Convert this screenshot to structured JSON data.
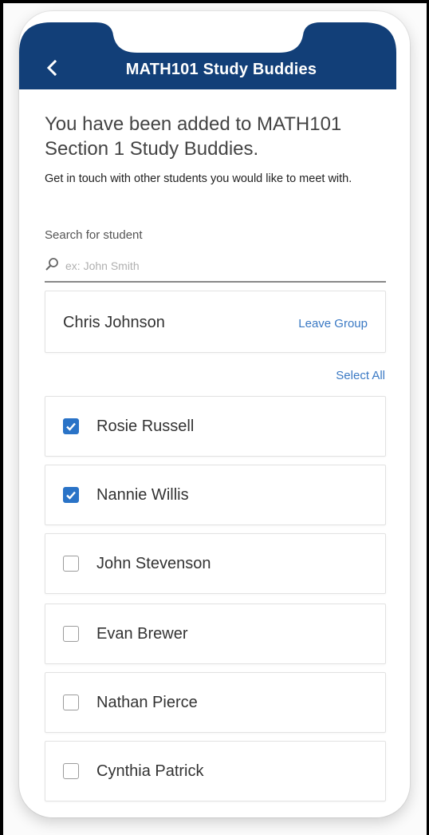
{
  "header": {
    "title": "MATH101 Study Buddies"
  },
  "intro": {
    "heading": "You have been added to MATH101 Section 1 Study Buddies.",
    "subtext": "Get in touch with other students you would like to meet with."
  },
  "search": {
    "label": "Search for student",
    "placeholder": "ex: John Smith",
    "value": ""
  },
  "owner": {
    "name": "Chris Johnson",
    "action": "Leave Group"
  },
  "select_all": "Select All",
  "students": [
    {
      "name": "Rosie Russell",
      "checked": true
    },
    {
      "name": "Nannie Willis",
      "checked": true
    },
    {
      "name": "John Stevenson",
      "checked": false
    },
    {
      "name": "Evan Brewer",
      "checked": false
    },
    {
      "name": "Nathan Pierce",
      "checked": false
    },
    {
      "name": "Cynthia Patrick",
      "checked": false
    }
  ],
  "colors": {
    "header": "#123f78",
    "accent": "#3a79c4",
    "check": "#2a73c7"
  },
  "icons": {
    "back": "chevron-left-icon",
    "search": "search-icon",
    "check": "checkmark-icon"
  }
}
